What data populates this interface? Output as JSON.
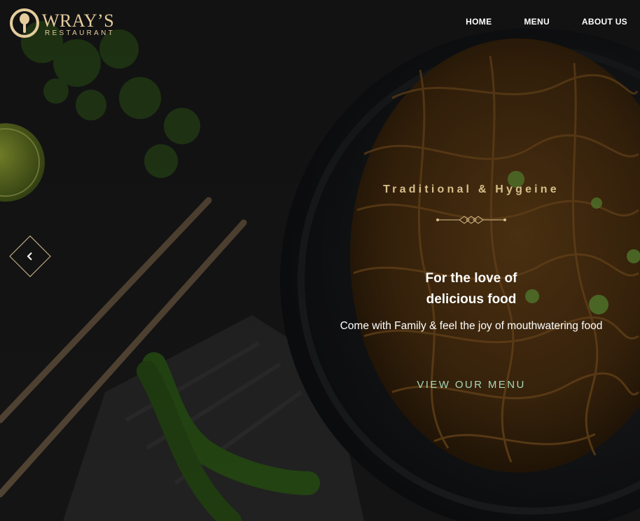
{
  "brand": {
    "name": "WRAY’S",
    "subtitle": "RESTAURANT",
    "logo_icon": "plate-spoon-icon",
    "color": "#e4cc9c"
  },
  "nav": {
    "items": [
      {
        "label": "HOME"
      },
      {
        "label": "MENU"
      },
      {
        "label": "ABOUT US"
      }
    ]
  },
  "slider": {
    "prev_icon": "chevron-left-icon"
  },
  "hero": {
    "tagline": "Traditional & Hygeine",
    "headline_line1": "For the love of",
    "headline_line2": "delicious food",
    "subtext": "Come with Family & feel the joy of mouthwatering food",
    "cta_label": "VIEW OUR MENU",
    "accent_color": "#d7bf8b",
    "cta_color": "#a6d8b4"
  }
}
